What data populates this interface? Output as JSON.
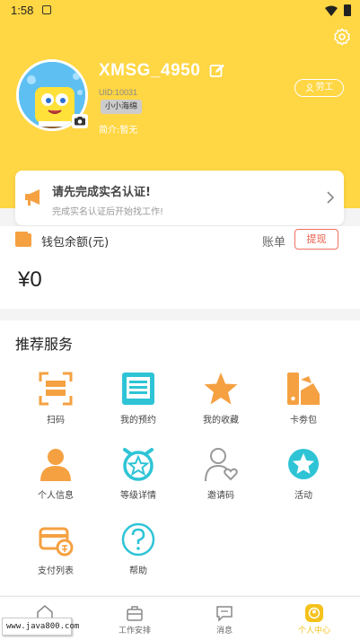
{
  "status_bar": {
    "time": "1:58"
  },
  "profile": {
    "username": "XMSG_4950",
    "uid": "UID:10031",
    "tag": "小小海绵",
    "bio": "简介:暂无",
    "worker_button": "劳工"
  },
  "verify_card": {
    "title": "请先完成实名认证!",
    "subtitle": "完成实名认证后开始找工作!"
  },
  "wallet": {
    "label": "钱包余额(元)",
    "bill_link": "账单",
    "withdraw_button": "提现",
    "balance": "¥0"
  },
  "services": {
    "title": "推荐服务",
    "items": [
      {
        "label": "扫码",
        "icon": "scan-icon"
      },
      {
        "label": "我的预约",
        "icon": "appointment-icon"
      },
      {
        "label": "我的收藏",
        "icon": "star-icon"
      },
      {
        "label": "卡劵包",
        "icon": "card-wallet-icon"
      },
      {
        "label": "个人信息",
        "icon": "person-icon"
      },
      {
        "label": "等级详情",
        "icon": "level-icon"
      },
      {
        "label": "邀请码",
        "icon": "invite-icon"
      },
      {
        "label": "活动",
        "icon": "activity-icon"
      },
      {
        "label": "支付列表",
        "icon": "payment-icon"
      },
      {
        "label": "帮助",
        "icon": "help-icon"
      }
    ]
  },
  "tabbar": {
    "tabs": [
      {
        "label": "首页",
        "icon": "home-icon"
      },
      {
        "label": "工作安排",
        "icon": "briefcase-icon"
      },
      {
        "label": "消息",
        "icon": "message-icon"
      },
      {
        "label": "个人中心",
        "icon": "profile-icon"
      }
    ],
    "active_index": 3
  },
  "watermark": {
    "text": "www.java800.com"
  },
  "colors": {
    "brand_yellow": "#FFD644",
    "orange": "#F5A142",
    "teal": "#2EC4D6",
    "active_tab": "#F4C21A",
    "withdraw_red": "#E85C4A"
  }
}
